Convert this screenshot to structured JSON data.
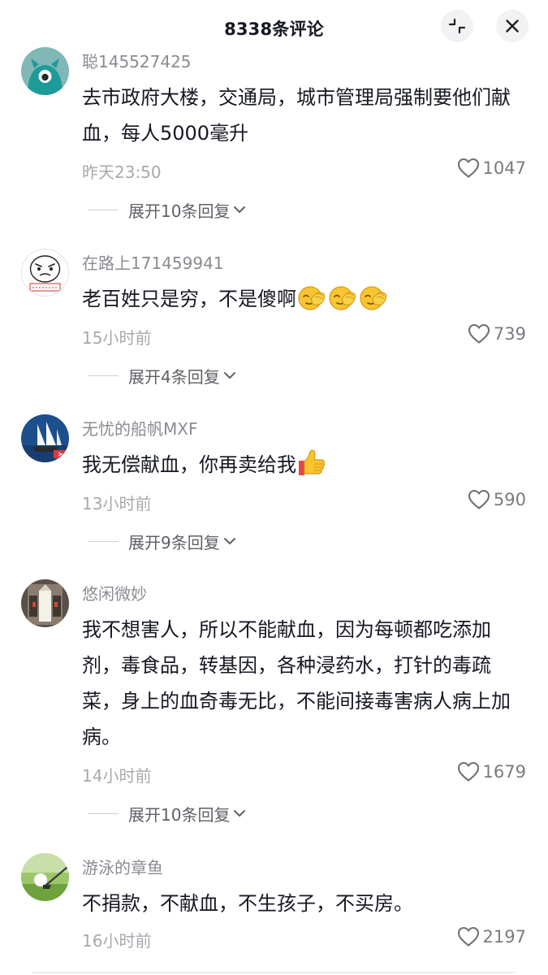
{
  "header": {
    "title": "8338条评论",
    "collapse_icon": "collapse-icon",
    "close_icon": "close-icon"
  },
  "comments": [
    {
      "username": "聪145527425",
      "text": "去市政府大楼，交通局，城市管理局强制要他们献血，每人5000毫升",
      "time": "昨天23:50",
      "likes": "1047",
      "replies": "展开10条回复",
      "avatar_icon": "cartoon-avatar-icon"
    },
    {
      "username": "在路上171459941",
      "text": "老百姓只是穷，不是傻啊",
      "emoji": [
        "facepalm-emoji",
        "facepalm-emoji",
        "facepalm-emoji"
      ],
      "time": "15小时前",
      "likes": "739",
      "replies": "展开4条回复",
      "avatar_icon": "sketch-face-avatar-icon"
    },
    {
      "username": "无忧的船帆MXF",
      "text": "我无偿献血，你再卖给我",
      "emoji": [
        "thumbs-up-emoji"
      ],
      "time": "13小时前",
      "likes": "590",
      "replies": "展开9条回复",
      "avatar_icon": "sailing-ship-avatar-icon"
    },
    {
      "username": "悠闲微妙",
      "text": "我不想害人，所以不能献血，因为每顿都吃添加剂，毒食品，转基因，各种浸药水，打针的毒疏菜，身上的血奇毒无比，不能间接毒害病人病上加病。",
      "time": "14小时前",
      "likes": "1679",
      "replies": "展开10条回复",
      "avatar_icon": "doorway-avatar-icon"
    },
    {
      "username": "游泳的章鱼",
      "text": "不捐款，不献血，不生孩子，不买房。",
      "time": "16小时前",
      "likes": "2197",
      "avatar_icon": "golf-ball-avatar-icon"
    }
  ],
  "icons": {
    "like": "heart-outline-icon",
    "expand": "chevron-down-icon"
  },
  "colors": {
    "text_primary": "#161823",
    "text_secondary": "#8a8b91",
    "emoji_yellow": "#f7c531",
    "thumb_red": "#e84545"
  }
}
